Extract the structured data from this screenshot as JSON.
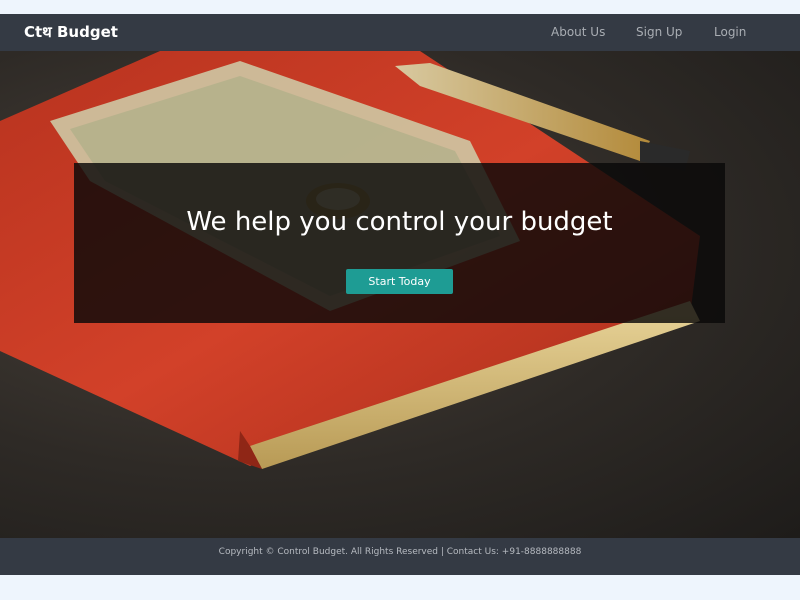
{
  "navbar": {
    "brand": "Ctथ Budget",
    "links": [
      {
        "label": "About Us"
      },
      {
        "label": "Sign Up"
      },
      {
        "label": "Login"
      }
    ]
  },
  "hero": {
    "headline": "We help you control your budget",
    "cta_label": "Start Today",
    "image": "background photo: red notebook with indian currency notes, coin and pen"
  },
  "footer": {
    "text": "Copyright © Control Budget. All Rights Reserved | Contact Us: +91-8888888888"
  },
  "colors": {
    "navbar_bg": "#343a44",
    "page_bg": "#eef5fd",
    "cta_bg": "#1e9c94",
    "notebook": "#c93a24"
  }
}
